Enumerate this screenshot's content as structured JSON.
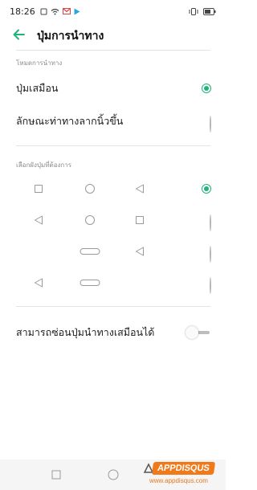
{
  "status_bar": {
    "time": "18:26",
    "icons": [
      "notification-icon",
      "wifi-icon",
      "gmail-icon",
      "play-store-icon"
    ],
    "right_icons": [
      "vibrate-icon",
      "battery-icon"
    ]
  },
  "header": {
    "title": "ปุ่มการนำทาง"
  },
  "nav_mode": {
    "section_label": "โหมดการนำทาง",
    "options": [
      {
        "label": "ปุ่มเสมือน",
        "selected": true
      },
      {
        "label": "ลักษณะท่าทางลากนิ้วขึ้น",
        "selected": false
      }
    ]
  },
  "button_layout": {
    "section_label": "เลือกผังปุ่มที่ต้องการ",
    "rows": [
      {
        "icons": [
          "square-icon",
          "circle-icon",
          "triangle-back-icon"
        ],
        "selected": true
      },
      {
        "icons": [
          "triangle-back-icon",
          "circle-icon",
          "square-icon"
        ],
        "selected": false
      },
      {
        "icons": [
          "",
          "pill-icon",
          "triangle-back-icon"
        ],
        "selected": false
      },
      {
        "icons": [
          "triangle-back-icon",
          "pill-icon",
          ""
        ],
        "selected": false
      }
    ]
  },
  "hide_toggle": {
    "label": "สามารถซ่อนปุ่มนำทางเสมือนได้",
    "enabled": false
  },
  "watermark": {
    "brand": "APPDISQUS",
    "url": "www.appdisqus.com"
  },
  "colors": {
    "accent": "#1fb47a",
    "watermark": "#f07a1a"
  }
}
